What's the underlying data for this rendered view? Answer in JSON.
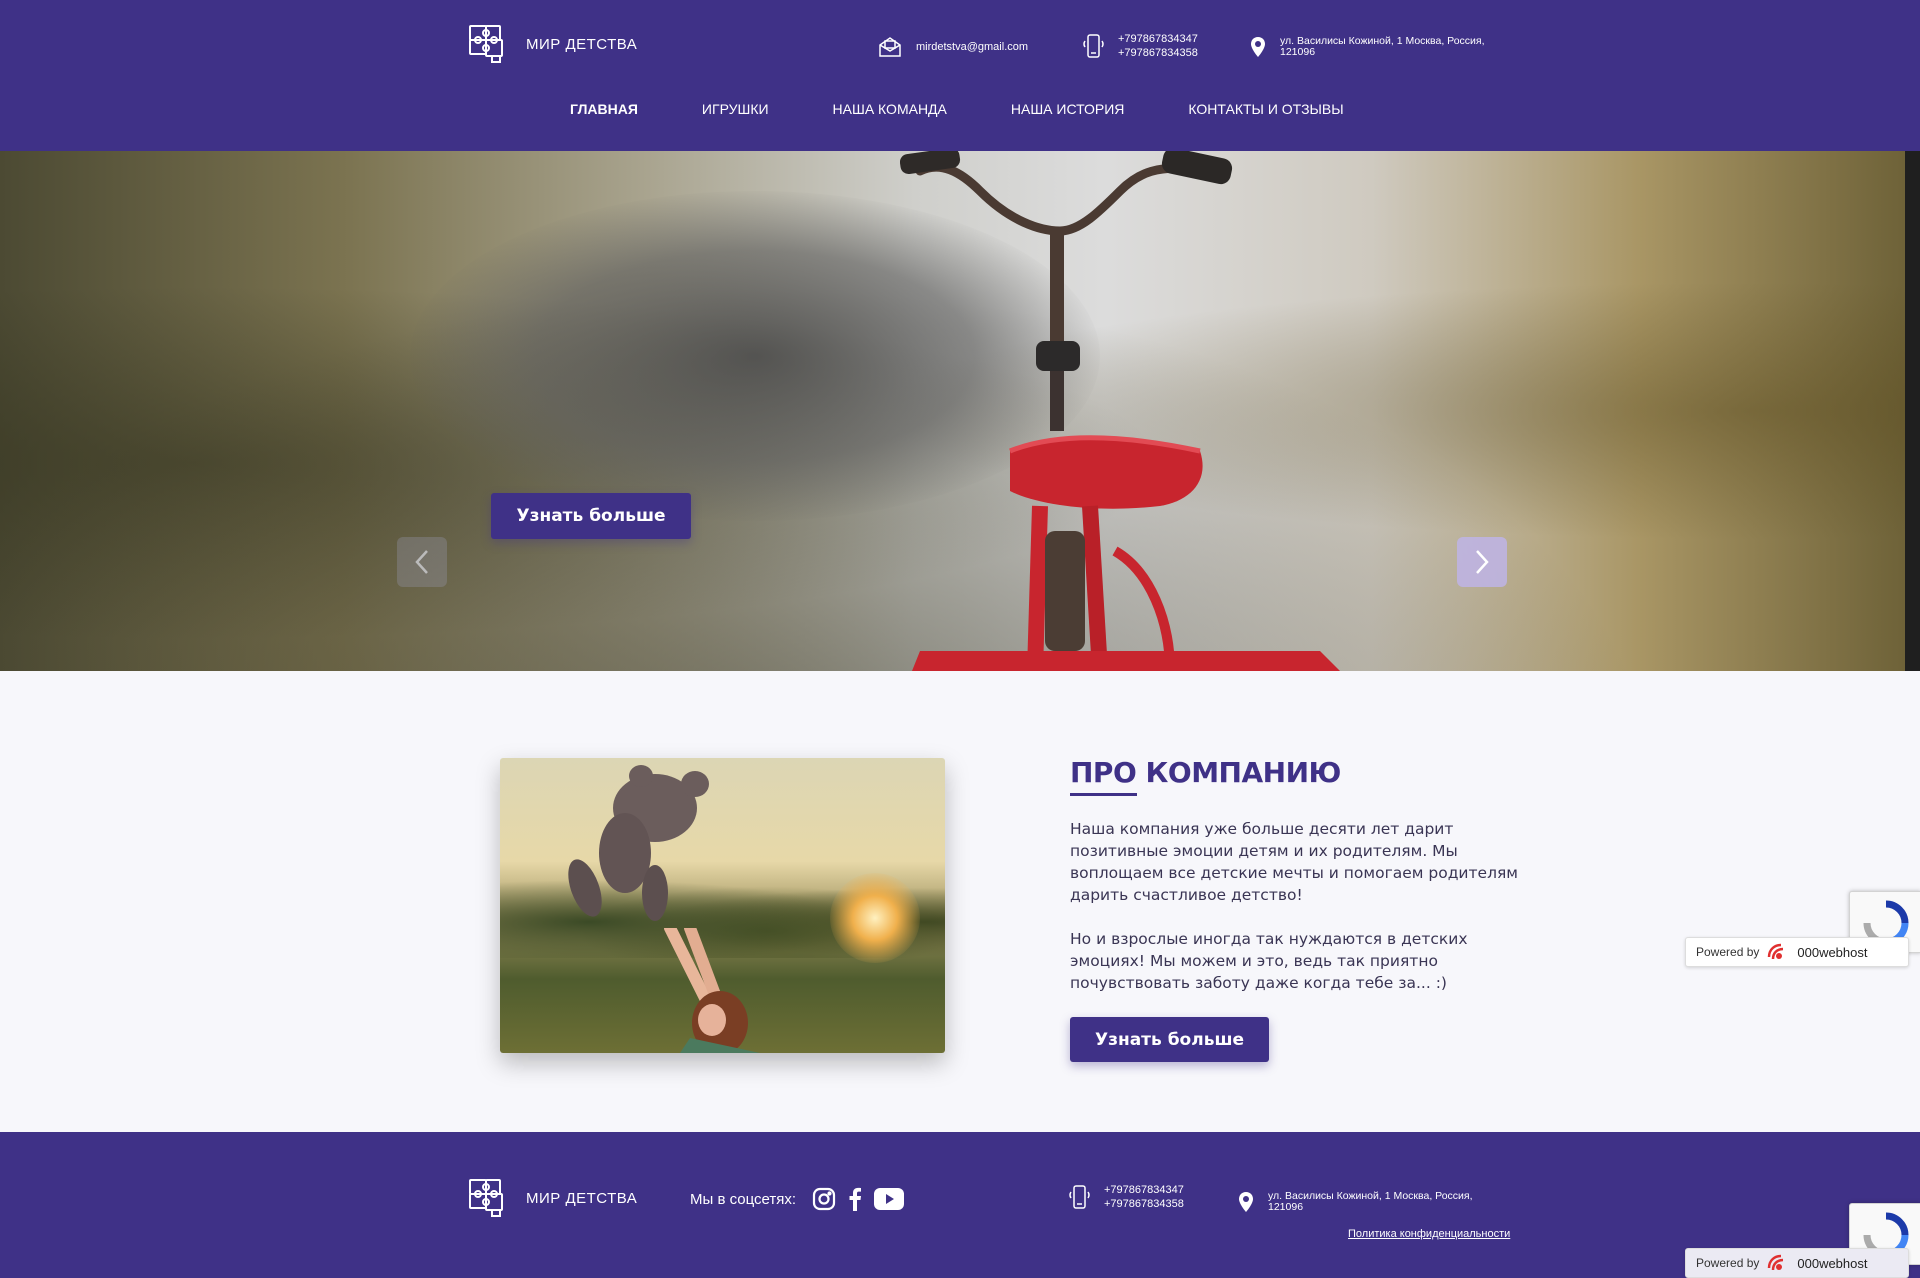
{
  "brand": {
    "name": "МИР ДЕТСТВА"
  },
  "header": {
    "email": "mirdetstva@gmail.com",
    "phones": [
      "+797867834347",
      "+797867834358"
    ],
    "address": "ул. Василисы Кожиной, 1 Москва, Россия, 121096"
  },
  "nav": {
    "items": [
      {
        "label": "ГЛАВНАЯ",
        "active": true
      },
      {
        "label": "ИГРУШКИ",
        "active": false
      },
      {
        "label": "НАША КОМАНДА",
        "active": false
      },
      {
        "label": "НАША ИСТОРИЯ",
        "active": false
      },
      {
        "label": "КОНТАКТЫ И ОТЗЫВЫ",
        "active": false
      }
    ]
  },
  "hero": {
    "button_label": "Узнать больше"
  },
  "about": {
    "title": "ПРО КОМПАНИЮ",
    "paragraph1": "Наша компания уже больше десяти лет дарит позитивные эмоции детям и их родителям. Мы воплощаем все детские мечты и помогаем родителям дарить счастливое детство!",
    "paragraph2": "Но и взрослые иногда так нуждаются в детских эмоциях! Мы можем и это, ведь так приятно почувствовать заботу даже когда тебе за... :)",
    "button_label": "Узнать больше"
  },
  "footer": {
    "social_label": "Мы в соцсетях:",
    "phones": [
      "+797867834347",
      "+797867834358"
    ],
    "address": "ул. Василисы Кожиной, 1 Москва, Россия, 121096",
    "privacy": "Политика конфиденциальности"
  },
  "widgets": {
    "powered_prefix": "Powered by",
    "powered_brand": "000webhost"
  },
  "colors": {
    "primary": "#3f3187",
    "background": "#f7f7fb"
  },
  "icons": [
    "logo-puzzle-icon",
    "mail-icon",
    "phone-icon",
    "location-pin-icon",
    "chevron-left-icon",
    "chevron-right-icon",
    "instagram-icon",
    "facebook-icon",
    "youtube-icon",
    "recaptcha-icon"
  ]
}
